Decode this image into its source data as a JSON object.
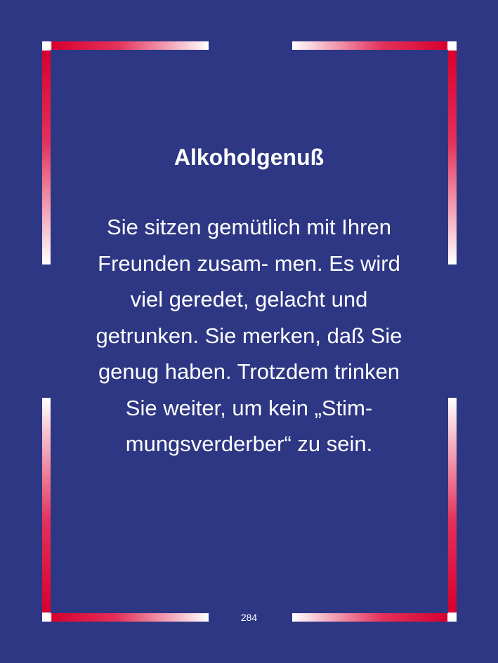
{
  "page": {
    "background_color": "#2e3784",
    "frame_colors": {
      "accent": "#d8002f",
      "fade": "#ffffff"
    },
    "title": "Alkoholgenuß",
    "body_lines": [
      " Sie sitzen gemütlich mit Ihren",
      "Freunden zusam- men. Es wird",
      "viel geredet, gelacht und",
      "getrunken. Sie merken, daß Sie",
      "genug haben. Trotzdem trinken",
      "Sie weiter, um kein „Stim-",
      "mungsverderber“ zu sein."
    ],
    "page_number": "284"
  }
}
